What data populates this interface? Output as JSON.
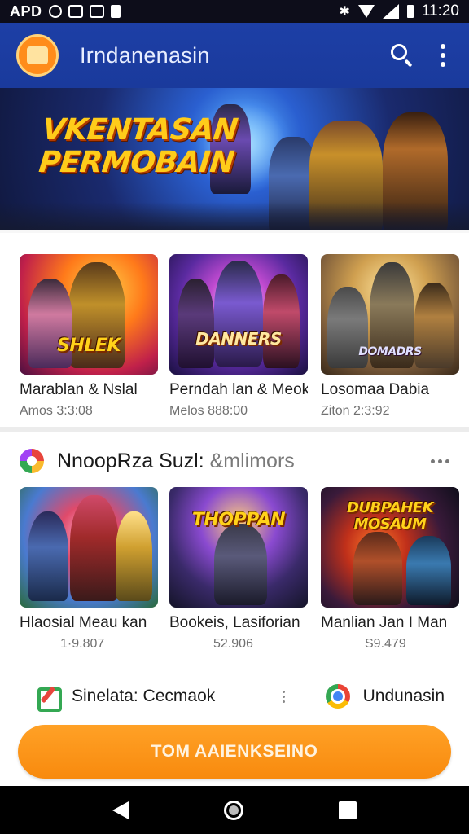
{
  "status_bar": {
    "carrier": "APD",
    "time": "11:20",
    "icons": [
      "notification-icon",
      "media-icon",
      "mail-icon",
      "flag-icon",
      "bluetooth-icon",
      "wifi-icon",
      "signal-icon",
      "battery-icon"
    ]
  },
  "app_bar": {
    "title": "Irndanenasin",
    "logo_icon": "shield-logo-icon",
    "search_icon": "search-icon",
    "more_icon": "more-vert-icon"
  },
  "banner": {
    "title_line1": "VKENTASAN",
    "title_line2": "PERMOBAIN"
  },
  "row1": [
    {
      "art": "SHLEK",
      "name": "Marablan & Nslal",
      "sub": "Amos 3:3:08"
    },
    {
      "art": "DANNERS",
      "name": "Perndah lan & Meok",
      "sub": "Melos 888:00"
    },
    {
      "art": "DOMADRS",
      "name": "Losomaa Dabia",
      "sub": "Ziton 2:3:92"
    }
  ],
  "section2": {
    "title": "NnoopRza  Suzl:",
    "title_muted": "&mlimors",
    "icon": "games-category-icon",
    "more_icon": "more-horiz-icon"
  },
  "row2": [
    {
      "art": "",
      "name": "Hlaosial Meau kan",
      "sub": "1·9.807"
    },
    {
      "art": "THOPPAN",
      "name": "Bookeis, Lasiforian",
      "sub": "52.906"
    },
    {
      "art": "DUBPAHEK MOSAUM",
      "name": "Manlian Jan I Man",
      "sub": "S9.479"
    }
  ],
  "promo": [
    {
      "label": "Sinelata: Cecmaok",
      "icon": "play-games-icon"
    },
    {
      "label": "Undunasin",
      "icon": "chrome-icon"
    }
  ],
  "cta": {
    "label": "TOM AAIENKSEINO"
  },
  "nav": {
    "back": "back-icon",
    "home": "home-icon",
    "recents": "recents-icon"
  },
  "colors": {
    "app_bar": "#1a3a9c",
    "accent": "#f88a0e",
    "status_bar": "#0d0d1a"
  }
}
